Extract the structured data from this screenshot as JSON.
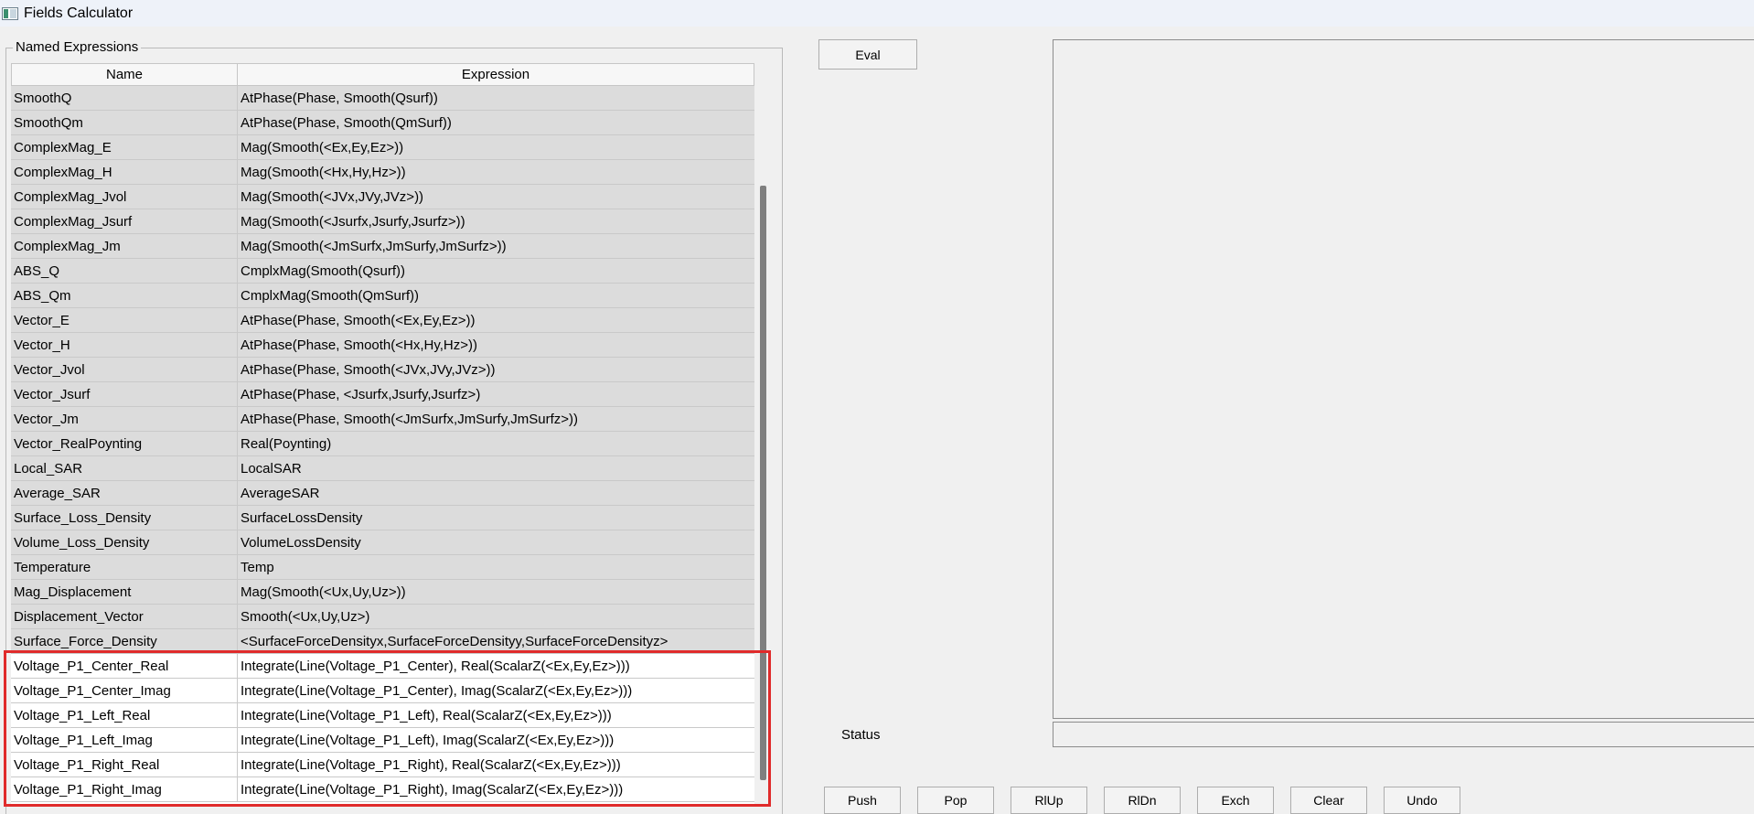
{
  "window": {
    "title": "Fields Calculator"
  },
  "named_expressions": {
    "group_label": "Named Expressions",
    "columns": {
      "name": "Name",
      "expression": "Expression"
    },
    "rows": [
      {
        "name": "SmoothQ",
        "expression": "AtPhase(Phase, Smooth(Qsurf))",
        "shade": "gray"
      },
      {
        "name": "SmoothQm",
        "expression": "AtPhase(Phase, Smooth(QmSurf))",
        "shade": "gray"
      },
      {
        "name": "ComplexMag_E",
        "expression": "Mag(Smooth(<Ex,Ey,Ez>))",
        "shade": "gray"
      },
      {
        "name": "ComplexMag_H",
        "expression": "Mag(Smooth(<Hx,Hy,Hz>))",
        "shade": "gray"
      },
      {
        "name": "ComplexMag_Jvol",
        "expression": "Mag(Smooth(<JVx,JVy,JVz>))",
        "shade": "gray"
      },
      {
        "name": "ComplexMag_Jsurf",
        "expression": "Mag(Smooth(<Jsurfx,Jsurfy,Jsurfz>))",
        "shade": "gray"
      },
      {
        "name": "ComplexMag_Jm",
        "expression": "Mag(Smooth(<JmSurfx,JmSurfy,JmSurfz>))",
        "shade": "gray"
      },
      {
        "name": "ABS_Q",
        "expression": "CmplxMag(Smooth(Qsurf))",
        "shade": "gray"
      },
      {
        "name": "ABS_Qm",
        "expression": "CmplxMag(Smooth(QmSurf))",
        "shade": "gray"
      },
      {
        "name": "Vector_E",
        "expression": "AtPhase(Phase, Smooth(<Ex,Ey,Ez>))",
        "shade": "gray"
      },
      {
        "name": "Vector_H",
        "expression": "AtPhase(Phase, Smooth(<Hx,Hy,Hz>))",
        "shade": "gray"
      },
      {
        "name": "Vector_Jvol",
        "expression": "AtPhase(Phase, Smooth(<JVx,JVy,JVz>))",
        "shade": "gray"
      },
      {
        "name": "Vector_Jsurf",
        "expression": "AtPhase(Phase, <Jsurfx,Jsurfy,Jsurfz>)",
        "shade": "gray"
      },
      {
        "name": "Vector_Jm",
        "expression": "AtPhase(Phase, Smooth(<JmSurfx,JmSurfy,JmSurfz>))",
        "shade": "gray"
      },
      {
        "name": "Vector_RealPoynting",
        "expression": "Real(Poynting)",
        "shade": "gray"
      },
      {
        "name": "Local_SAR",
        "expression": "LocalSAR",
        "shade": "gray"
      },
      {
        "name": "Average_SAR",
        "expression": "AverageSAR",
        "shade": "gray"
      },
      {
        "name": "Surface_Loss_Density",
        "expression": "SurfaceLossDensity",
        "shade": "gray"
      },
      {
        "name": "Volume_Loss_Density",
        "expression": "VolumeLossDensity",
        "shade": "gray"
      },
      {
        "name": "Temperature",
        "expression": "Temp",
        "shade": "gray"
      },
      {
        "name": "Mag_Displacement",
        "expression": "Mag(Smooth(<Ux,Uy,Uz>))",
        "shade": "gray"
      },
      {
        "name": "Displacement_Vector",
        "expression": "Smooth(<Ux,Uy,Uz>)",
        "shade": "gray"
      },
      {
        "name": "Surface_Force_Density",
        "expression": "<SurfaceForceDensityx,SurfaceForceDensityy,SurfaceForceDensityz>",
        "shade": "gray"
      },
      {
        "name": "Voltage_P1_Center_Real",
        "expression": "Integrate(Line(Voltage_P1_Center), Real(ScalarZ(<Ex,Ey,Ez>)))",
        "shade": "white"
      },
      {
        "name": "Voltage_P1_Center_Imag",
        "expression": "Integrate(Line(Voltage_P1_Center), Imag(ScalarZ(<Ex,Ey,Ez>)))",
        "shade": "white"
      },
      {
        "name": "Voltage_P1_Left_Real",
        "expression": "Integrate(Line(Voltage_P1_Left), Real(ScalarZ(<Ex,Ey,Ez>)))",
        "shade": "white"
      },
      {
        "name": "Voltage_P1_Left_Imag",
        "expression": "Integrate(Line(Voltage_P1_Left), Imag(ScalarZ(<Ex,Ey,Ez>)))",
        "shade": "white"
      },
      {
        "name": "Voltage_P1_Right_Real",
        "expression": "Integrate(Line(Voltage_P1_Right), Real(ScalarZ(<Ex,Ey,Ez>)))",
        "shade": "white"
      },
      {
        "name": "Voltage_P1_Right_Imag",
        "expression": "Integrate(Line(Voltage_P1_Right), Imag(ScalarZ(<Ex,Ey,Ez>)))",
        "shade": "white"
      }
    ]
  },
  "highlight": {
    "color": "#e02b2b"
  },
  "eval_button": "Eval",
  "status": {
    "label": "Status",
    "value": ""
  },
  "stack_buttons": {
    "push": "Push",
    "pop": "Pop",
    "rlup": "RlUp",
    "rldn": "RlDn",
    "exch": "Exch",
    "clear": "Clear",
    "undo": "Undo"
  }
}
